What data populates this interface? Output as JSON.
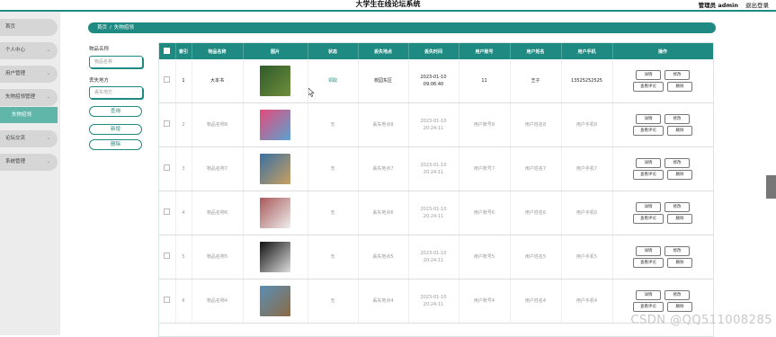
{
  "header": {
    "title": "大学生在线论坛系统",
    "admin": "管理员 admin",
    "logout": "退出登录"
  },
  "sidebar": {
    "items": [
      {
        "label": "首页"
      },
      {
        "label": "个人中心",
        "chevron": "⌄"
      },
      {
        "label": "用户管理",
        "chevron": "⌄"
      },
      {
        "label": "失物招领管理",
        "chevron": "⌄"
      },
      {
        "label": "失物招领"
      },
      {
        "label": "论坛交流",
        "chevron": "⌄"
      },
      {
        "label": "系统管理",
        "chevron": "⌄"
      }
    ]
  },
  "breadcrumb": {
    "home": "首页",
    "sep": "/",
    "current": "失物招领"
  },
  "search": {
    "item_name_label": "物品名称",
    "item_name_placeholder": "物品名称",
    "location_label": "丢失地方",
    "location_placeholder": "丢失地方",
    "query_btn": "查询",
    "add_btn": "新增",
    "delete_btn": "删除"
  },
  "table": {
    "headers": [
      "索引",
      "物品名称",
      "图片",
      "状态",
      "丢失地点",
      "丢失时间",
      "用户账号",
      "用户姓名",
      "用户手机",
      "操作"
    ],
    "actions": {
      "detail": "详情",
      "edit": "修改",
      "comments": "查看评论",
      "delete": "删除"
    },
    "rows": [
      {
        "index": "1",
        "name": "大本书",
        "status": "领取",
        "location": "校园东区",
        "time": "2023-01-10 09:06:40",
        "account": "11",
        "username": "王子",
        "phone": "13525252525",
        "img_colors": [
          "#2f5a2a",
          "#6f8e3c"
        ]
      },
      {
        "index": "2",
        "name": "物品名称8",
        "status": "无",
        "location": "丢失地点8",
        "time": "2023-01-10 20:24:11",
        "account": "用户账号8",
        "username": "用户姓名8",
        "phone": "用户手机8",
        "img_colors": [
          "#e64a7b",
          "#5aa3cf"
        ]
      },
      {
        "index": "3",
        "name": "物品名称7",
        "status": "无",
        "location": "丢失地点7",
        "time": "2023-01-10 20:24:11",
        "account": "用户账号7",
        "username": "用户姓名7",
        "phone": "用户手机7",
        "img_colors": [
          "#3a6fa1",
          "#c8a060"
        ]
      },
      {
        "index": "4",
        "name": "物品名称6",
        "status": "无",
        "location": "丢失地点6",
        "time": "2023-01-10 20:24:11",
        "account": "用户账号6",
        "username": "用户姓名6",
        "phone": "用户手机6",
        "img_colors": [
          "#a85858",
          "#eeeeee"
        ]
      },
      {
        "index": "5",
        "name": "物品名称5",
        "status": "无",
        "location": "丢失地点5",
        "time": "2023-01-10 20:24:11",
        "account": "用户账号5",
        "username": "用户姓名5",
        "phone": "用户手机5",
        "img_colors": [
          "#111111",
          "#dddddd"
        ]
      },
      {
        "index": "6",
        "name": "物品名称4",
        "status": "无",
        "location": "丢失地点4",
        "time": "2023-01-10 20:24:11",
        "account": "用户账号4",
        "username": "用户姓名4",
        "phone": "用户手机4",
        "img_colors": [
          "#5a8fb5",
          "#8b6a44"
        ]
      }
    ]
  },
  "watermark": "CSDN @QQ511008285",
  "colors": {
    "accent": "#1f8a82",
    "sidebar_bg": "#ececec",
    "sidebar_active": "#5fb6a9"
  }
}
